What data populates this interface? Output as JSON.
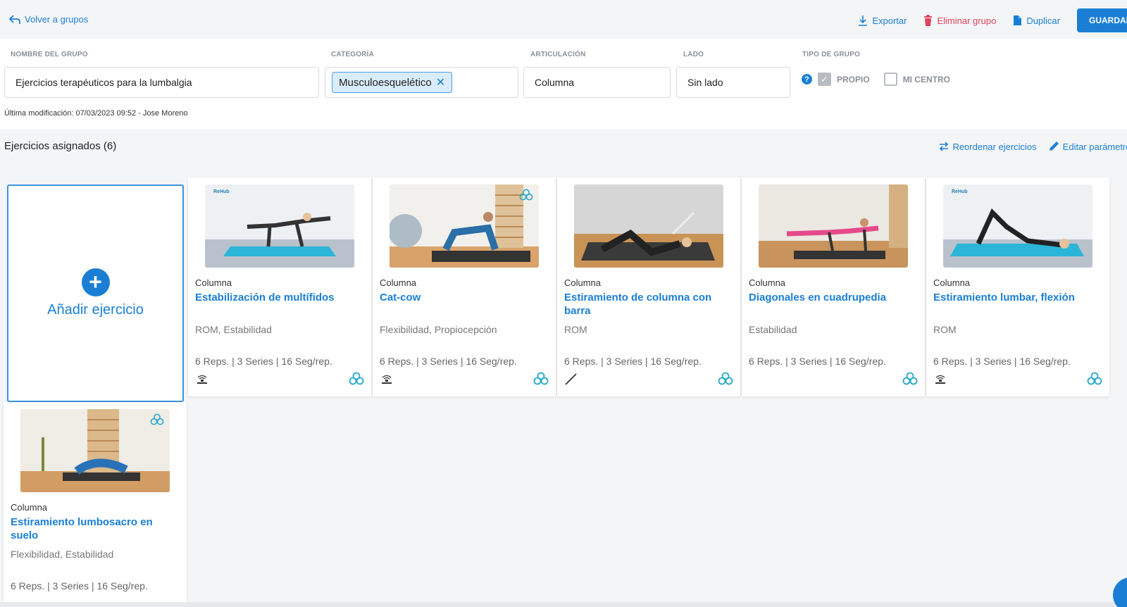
{
  "topbar": {
    "back_label": "Volver a grupos",
    "export_label": "Exportar",
    "delete_label": "Eliminar grupo",
    "duplicate_label": "Duplicar",
    "save_label": "GUARDAR"
  },
  "form": {
    "name_label": "NOMBRE DEL GRUPO",
    "name_value": "Ejercicios terapéuticos para la lumbalgia",
    "category_label": "CATEGORÍA",
    "category_chip": "Musculoesquelético",
    "joint_label": "ARTICULACIÓN",
    "joint_value": "Columna",
    "side_label": "LADO",
    "side_value": "Sin lado",
    "group_type_label": "TIPO DE GRUPO",
    "own_label": "PROPIO",
    "own_checked": true,
    "center_label": "MI CENTRO",
    "center_checked": false,
    "last_modified": "Última modificación: 07/03/2023 09:52 - Jose Moreno"
  },
  "section": {
    "title": "Ejercicios asignados",
    "count": "(6)",
    "reorder_label": "Reordenar ejercicios",
    "edit_label": "Editar parámetros"
  },
  "add_card": {
    "label": "Añadir ejercicio"
  },
  "logo_text": "ReHub",
  "colors": {
    "accent": "#1a7fd4",
    "danger": "#e0435c",
    "badge": "#27a9c9"
  },
  "exercises": [
    {
      "category": "Columna",
      "name": "Estabilización de multífidos",
      "tags": "ROM, Estabilidad",
      "params": "6 Reps. | 3 Series | 16 Seg/rep.",
      "left_icon": "sensor-icon",
      "right_icon": "rehub-badge-icon",
      "thumb_badge": false,
      "thumb_logo": true
    },
    {
      "category": "Columna",
      "name": "Cat-cow",
      "tags": "Flexibilidad, Propiocepción",
      "params": "6 Reps. | 3 Series | 16 Seg/rep.",
      "left_icon": "sensor-icon",
      "right_icon": "rehub-badge-icon",
      "thumb_badge": true,
      "thumb_logo": false
    },
    {
      "category": "Columna",
      "name": "Estiramiento de columna con barra",
      "tags": "ROM",
      "params": "6 Reps. | 3 Series | 16 Seg/rep.",
      "left_icon": "stick-icon",
      "right_icon": "rehub-badge-icon",
      "thumb_badge": false,
      "thumb_logo": false
    },
    {
      "category": "Columna",
      "name": "Diagonales en cuadrupedia",
      "tags": "Estabilidad",
      "params": "6 Reps. | 3 Series | 16 Seg/rep.",
      "left_icon": "",
      "right_icon": "rehub-badge-icon",
      "thumb_badge": false,
      "thumb_logo": false
    },
    {
      "category": "Columna",
      "name": "Estiramiento lumbar, flexión",
      "tags": "ROM",
      "params": "6 Reps. | 3 Series | 16 Seg/rep.",
      "left_icon": "sensor-icon",
      "right_icon": "rehub-badge-icon",
      "thumb_badge": false,
      "thumb_logo": true
    },
    {
      "category": "Columna",
      "name": "Estiramiento lumbosacro en suelo",
      "tags": "Flexibilidad, Estabilidad",
      "params": "6 Reps. | 3 Series | 16 Seg/rep.",
      "left_icon": "",
      "right_icon": "",
      "thumb_badge": true,
      "thumb_logo": false
    }
  ]
}
